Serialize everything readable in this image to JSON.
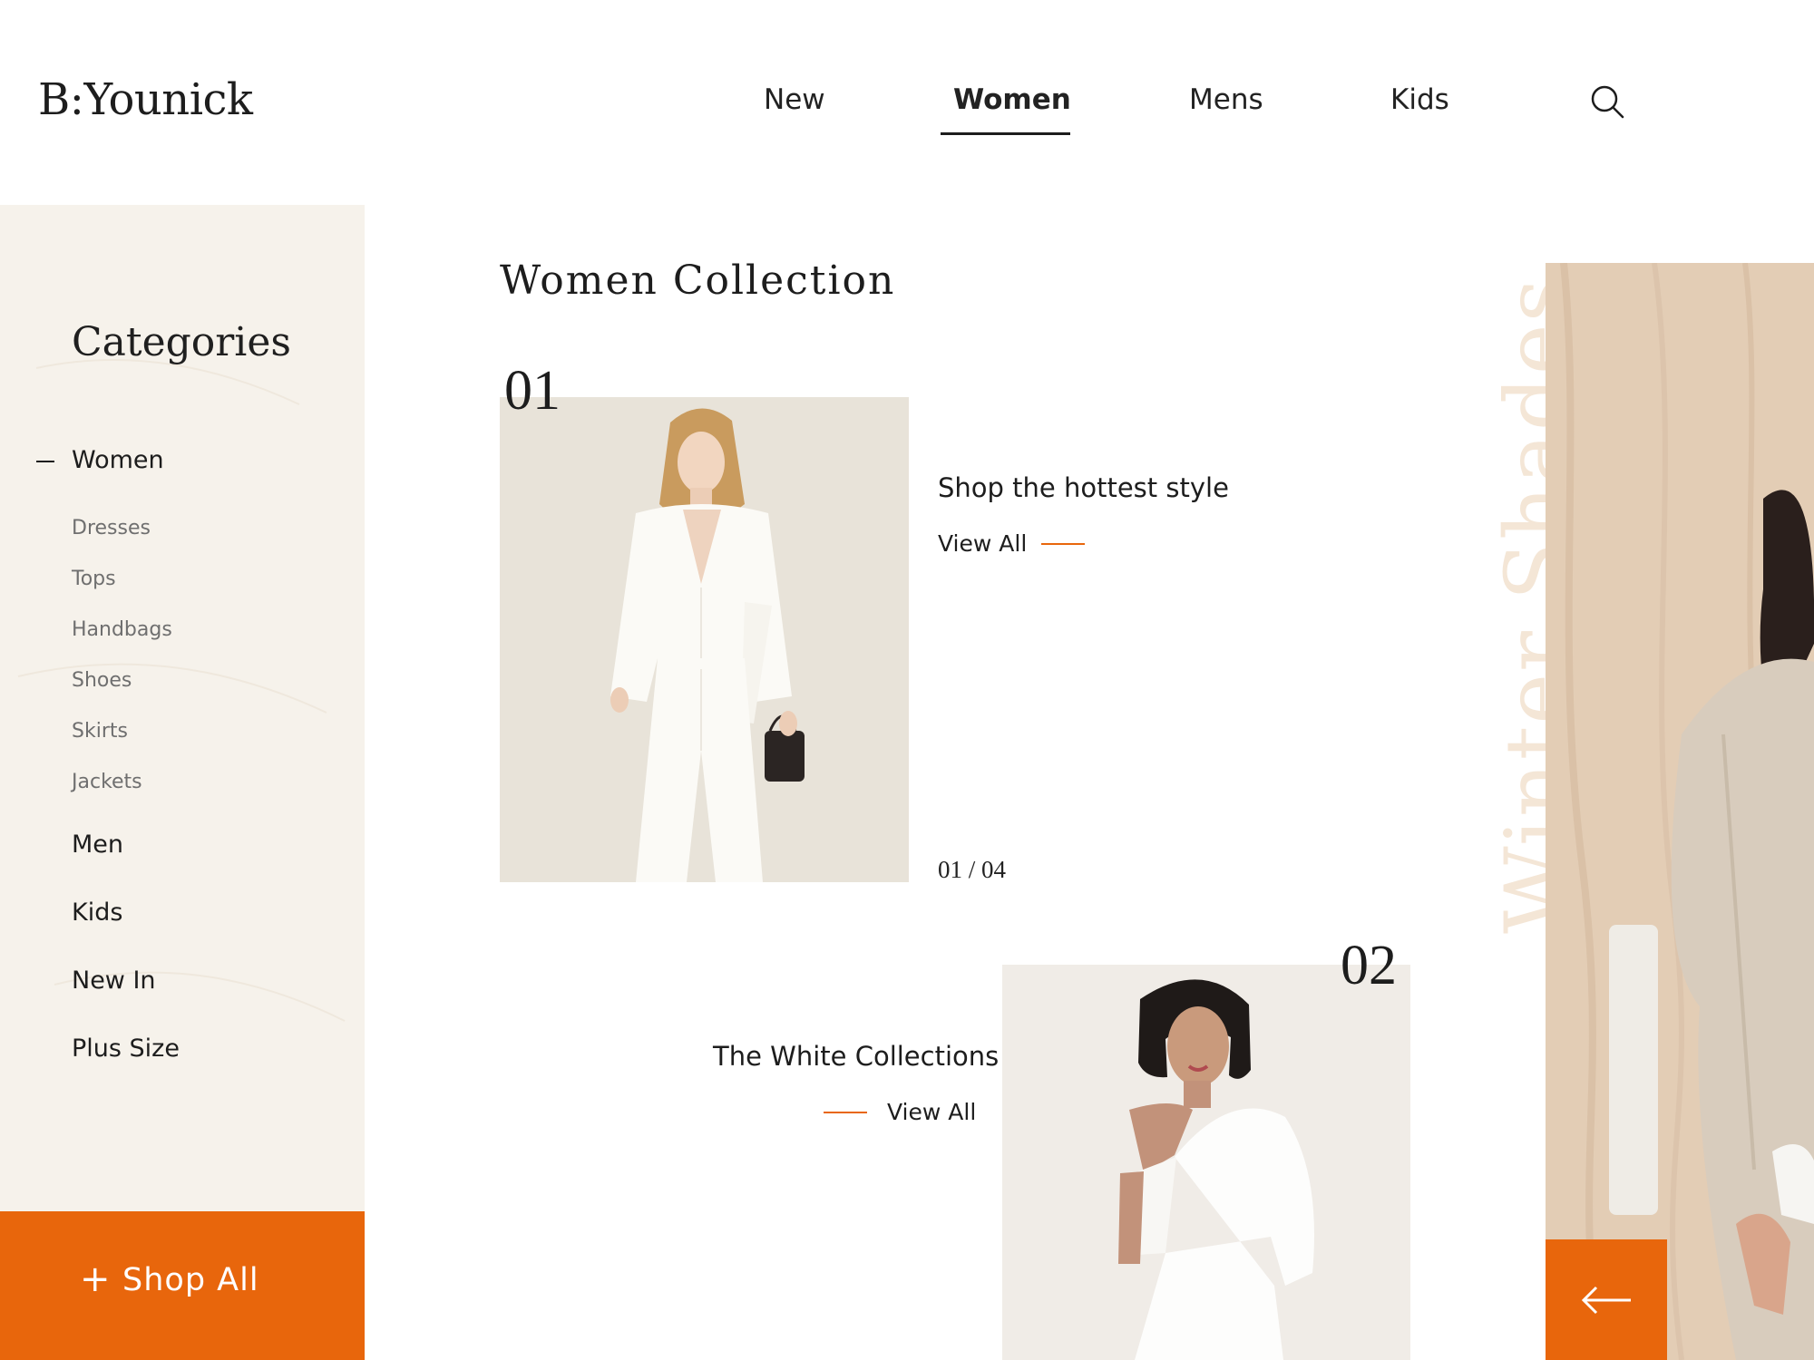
{
  "brand": {
    "logo": "B:Younick"
  },
  "nav": {
    "items": [
      "New",
      "Women",
      "Mens",
      "Kids"
    ],
    "active": "Women"
  },
  "sidebar": {
    "title": "Categories",
    "active_category": "Women",
    "sub_items": [
      "Dresses",
      "Tops",
      "Handbags",
      "Shoes",
      "Skirts",
      "Jackets"
    ],
    "categories": [
      "Men",
      "Kids",
      "New In",
      "Plus Size"
    ],
    "shop_all": {
      "icon": "plus-icon",
      "plus": "+",
      "label": "Shop All"
    }
  },
  "main": {
    "title": "Women Collection",
    "cards": [
      {
        "number": "01",
        "title": "Shop the hottest style",
        "view_all": "View All",
        "pager": "01 / 04"
      },
      {
        "number": "02",
        "title": "The White Collections",
        "view_all": "View All"
      }
    ]
  },
  "feature": {
    "vertical_text": "Winter Shades",
    "arrow_icon": "arrow-left-icon"
  },
  "colors": {
    "accent": "#e8660c",
    "sidebar_bg": "#f6f2eb",
    "vertical_text": "#f4e6d6",
    "text": "#1d1d1d"
  }
}
